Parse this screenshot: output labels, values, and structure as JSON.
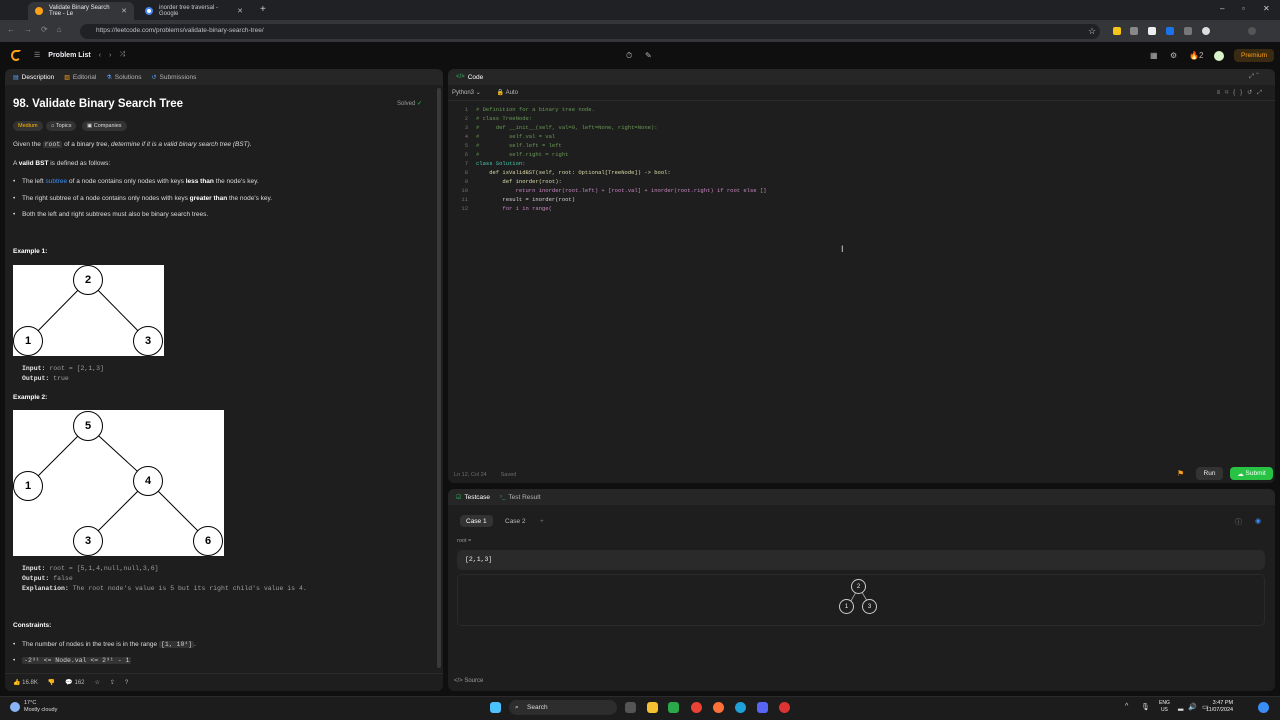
{
  "browser": {
    "tabs": [
      {
        "title": "Validate Binary Search Tree - Le"
      },
      {
        "title": "inorder tree traversal - Google"
      }
    ],
    "url": "https://leetcode.com/problems/validate-binary-search-tree/"
  },
  "nav": {
    "problem_list": "Problem List",
    "streak": "2",
    "premium": "Premium"
  },
  "description_panel": {
    "tabs": [
      "Description",
      "Editorial",
      "Solutions",
      "Submissions"
    ],
    "title": "98. Validate Binary Search Tree",
    "solved": "Solved",
    "badges": [
      "Medium",
      "Topics",
      "Companies"
    ],
    "intro_1": "Given the",
    "intro_code": "root",
    "intro_2": "of a binary tree,",
    "intro_em": "determine if it is a valid binary search tree (BST).",
    "def_1": "A",
    "def_b": "valid BST",
    "def_2": "is defined as follows:",
    "rule1_a": "The left",
    "rule1_link": "subtree",
    "rule1_b": "of a node contains only nodes with keys",
    "rule1_bold": "less than",
    "rule1_c": "the node's key.",
    "rule2_a": "The right subtree of a node contains only nodes with keys",
    "rule2_bold": "greater than",
    "rule2_b": "the node's key.",
    "rule3": "Both the left and right subtrees must also be binary search trees.",
    "example1": {
      "heading": "Example 1:",
      "nodes": [
        "2",
        "1",
        "3"
      ],
      "input_label": "Input:",
      "input": "root = [2,1,3]",
      "output_label": "Output:",
      "output": "true"
    },
    "example2": {
      "heading": "Example 2:",
      "nodes": [
        "5",
        "1",
        "4",
        "3",
        "6"
      ],
      "input_label": "Input:",
      "input": "root = [5,1,4,null,null,3,6]",
      "output_label": "Output:",
      "output": "false",
      "expl_label": "Explanation:",
      "explanation": "The root node's value is 5 but its right child's value is 4."
    },
    "constraints_heading": "Constraints:",
    "constraint1_a": "The number of nodes in the tree is in the range",
    "constraint1_code": "[1, 10⁴]",
    "constraint2_code": "-2³¹ <= Node.val <= 2³¹ - 1",
    "likes": "16.8K",
    "comments": "162"
  },
  "code_panel": {
    "title": "Code",
    "language": "Python3",
    "mode": "Auto",
    "lines": [
      "# Definition for a binary tree node.",
      "# class TreeNode:",
      "#     def __init__(self, val=0, left=None, right=None):",
      "#         self.val = val",
      "#         self.left = left",
      "#         self.right = right",
      "class Solution:",
      "    def isValidBST(self, root: Optional[TreeNode]) -> bool:",
      "        def inorder(root):",
      "            return inorder(root.left) + [root.val] + inorder(root.right) if root else []",
      "        result = inorder(root)",
      "        for i in range("
    ],
    "cursor_pos": "Ln 12, Col 24",
    "saved": "Saved",
    "run": "Run",
    "submit": "Submit"
  },
  "test_panel": {
    "tabs": [
      "Testcase",
      "Test Result"
    ],
    "cases": [
      "Case 1",
      "Case 2"
    ],
    "root_label": "root =",
    "root_value": "[2,1,3]",
    "tree_nodes": [
      "2",
      "1",
      "3"
    ],
    "source": "Source"
  },
  "taskbar": {
    "temp": "17°C",
    "weather": "Mostly cloudy",
    "search": "Search",
    "lang": "ENG",
    "region": "US",
    "time": "3:47 PM",
    "date": "11/07/2024"
  }
}
